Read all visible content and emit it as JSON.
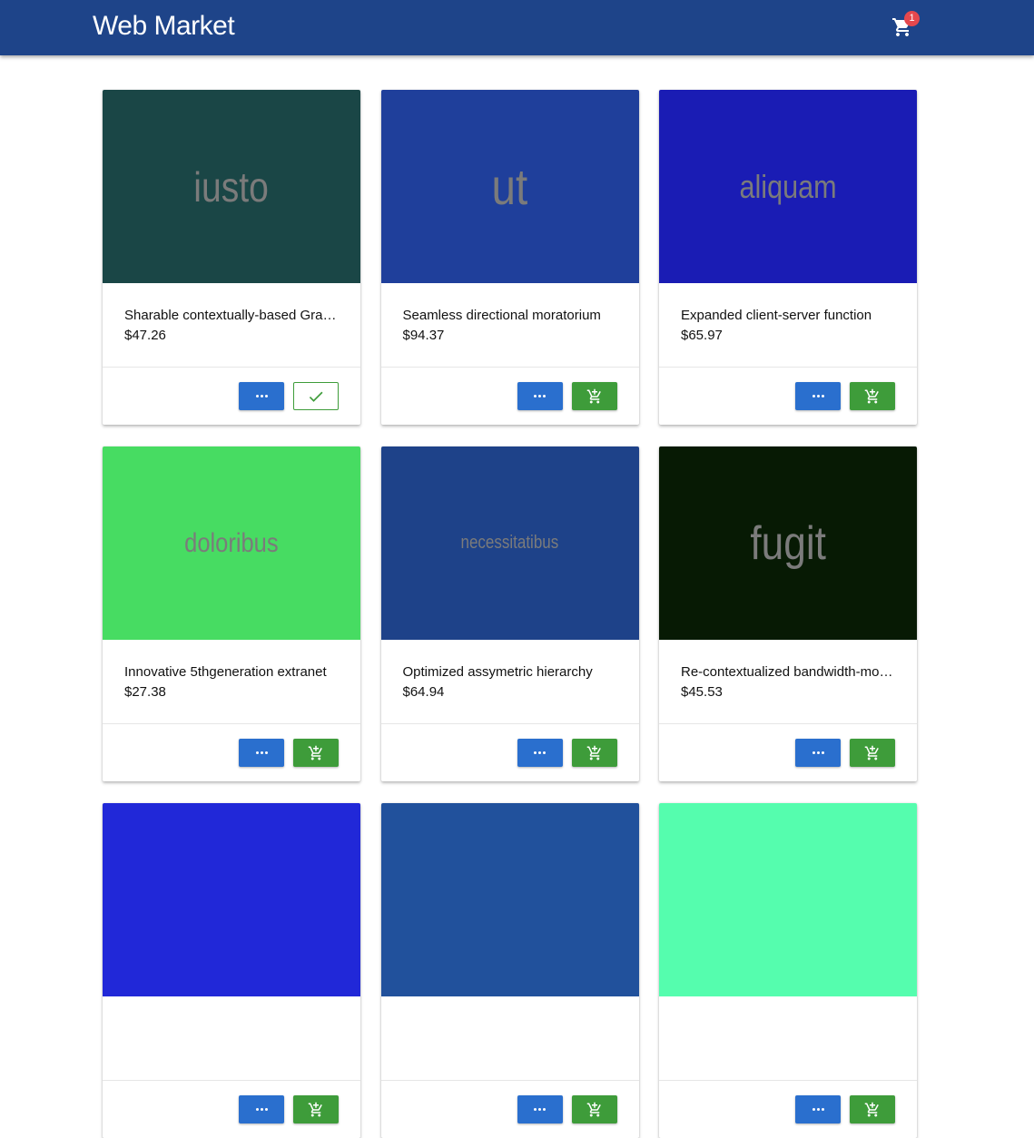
{
  "app": {
    "title": "Web Market",
    "cart_count": "1"
  },
  "products": [
    {
      "image_text": "iusto",
      "image_bg": "#1a4646",
      "title": "Sharable contextually-based Graphical User Interface",
      "price": "$47.26",
      "in_cart": true,
      "more_icon": "more-horizontal-icon",
      "cart_icon": "check-icon"
    },
    {
      "image_text": "ut",
      "image_bg": "#1f3f9b",
      "title": "Seamless directional moratorium",
      "price": "$94.37",
      "in_cart": false,
      "more_icon": "more-horizontal-icon",
      "cart_icon": "add-to-cart-icon"
    },
    {
      "image_text": "aliquam",
      "image_bg": "#1a1cb4",
      "title": "Expanded client-server function",
      "price": "$65.97",
      "in_cart": false,
      "more_icon": "more-horizontal-icon",
      "cart_icon": "add-to-cart-icon"
    },
    {
      "image_text": "doloribus",
      "image_bg": "#47dc62",
      "title": "Innovative 5thgeneration extranet",
      "price": "$27.38",
      "in_cart": false,
      "more_icon": "more-horizontal-icon",
      "cart_icon": "add-to-cart-icon"
    },
    {
      "image_text": "necessitatibus",
      "image_bg": "#1e4289",
      "title": "Optimized assymetric hierarchy",
      "price": "$64.94",
      "in_cart": false,
      "more_icon": "more-horizontal-icon",
      "cart_icon": "add-to-cart-icon"
    },
    {
      "image_text": "fugit",
      "image_bg": "#071a04",
      "title": "Re-contextualized bandwidth-monitored project",
      "price": "$45.53",
      "in_cart": false,
      "more_icon": "more-horizontal-icon",
      "cart_icon": "add-to-cart-icon"
    },
    {
      "image_text": "",
      "image_bg": "#2128d8",
      "title": "",
      "price": "",
      "in_cart": false
    },
    {
      "image_text": "",
      "image_bg": "#21519c",
      "title": "",
      "price": "",
      "in_cart": false
    },
    {
      "image_text": "",
      "image_bg": "#55fdae",
      "title": "",
      "price": "",
      "in_cart": false
    }
  ],
  "colors": {
    "navbar": "#1e4489",
    "more_button": "#2a6fce",
    "cart_button": "#3e9c3a",
    "badge": "#e5484d"
  }
}
